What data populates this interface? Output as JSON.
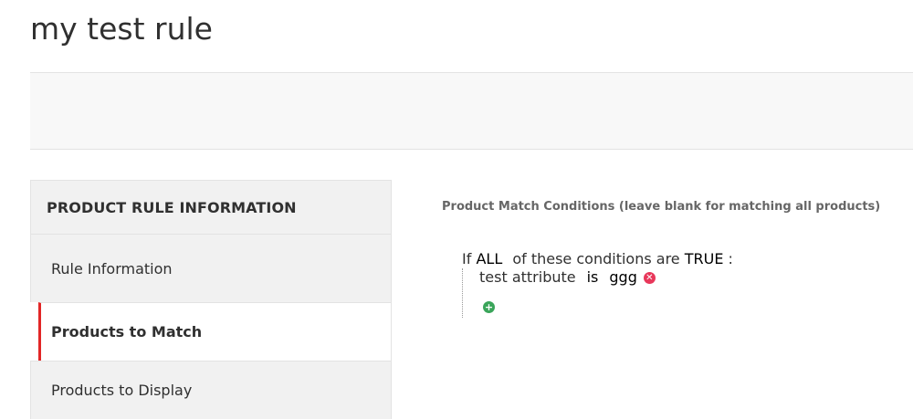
{
  "page": {
    "title": "my test rule"
  },
  "sidebar": {
    "header": "PRODUCT RULE INFORMATION",
    "items": [
      {
        "label": "Rule Information"
      },
      {
        "label": "Products to Match"
      },
      {
        "label": "Products to Display"
      }
    ],
    "active_index": 1
  },
  "content": {
    "section_label": "Product Match Conditions (leave blank for matching all products)",
    "conditions": {
      "prefix": "If",
      "aggregator": "ALL",
      "middle": "of these conditions are",
      "value": "TRUE",
      "suffix": ":",
      "children": [
        {
          "attribute": "test attribute",
          "operator": "is",
          "value": "ggg",
          "remove_icon": "remove-icon"
        }
      ],
      "add_icon": "add-icon"
    }
  },
  "colors": {
    "active_border": "#e22626",
    "remove_icon": "#e8375a",
    "add_icon": "#3aa55a"
  }
}
